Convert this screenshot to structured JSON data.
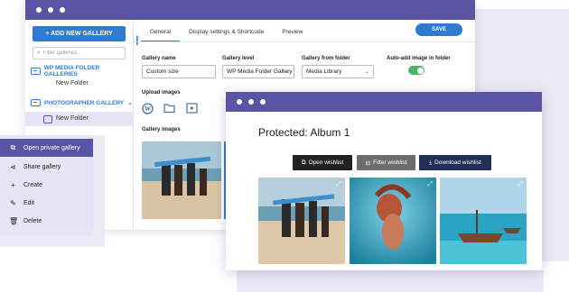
{
  "sidebar": {
    "add_button": "+ ADD NEW GALLERY",
    "filter_placeholder": "Filter galleries...",
    "wp_folder_label": "WP MEDIA FOLDER GALLERIES",
    "wp_new_folder": "New Folder",
    "photographer_label": "PHOTOGRAPHER GALLERY",
    "photographer_new_folder": "New Folder"
  },
  "tabs": [
    "General",
    "Display settings & Shortcode",
    "Preview"
  ],
  "save_label": "SAVE",
  "form": {
    "gallery_name_label": "Gallery name",
    "gallery_name_value": "Custom size",
    "gallery_level_label": "Gallery level",
    "gallery_level_value": "WP Media Folder Gallery",
    "from_folder_label": "Gallery from folder",
    "from_folder_value": "Media Library",
    "auto_add_label": "Auto-add image in folder",
    "auto_add_on": true,
    "upload_label": "Upload images",
    "gallery_images_label": "Gallery images"
  },
  "context_menu": [
    {
      "label": "Open private gallery",
      "icon": "external-link-icon",
      "active": true
    },
    {
      "label": "Share gallery",
      "icon": "share-icon",
      "active": false
    },
    {
      "label": "Create",
      "icon": "plus-icon",
      "active": false
    },
    {
      "label": "Edit",
      "icon": "pencil-icon",
      "active": false
    },
    {
      "label": "Delete",
      "icon": "trash-icon",
      "active": false
    }
  ],
  "front": {
    "title": "Protected: Album 1",
    "open_wishlist": "Open wishlist",
    "filter_wishlist": "Filter wishlist",
    "download_wishlist": "Download wishlist"
  },
  "colors": {
    "titlebar": "#5b53a4",
    "accent_blue": "#2d7bd3",
    "toggle_green": "#4db56b",
    "menu_bg": "#e7e5f5",
    "btn_dark": "#222222",
    "btn_gray": "#6d6d6d",
    "btn_navy": "#1f2f57"
  }
}
